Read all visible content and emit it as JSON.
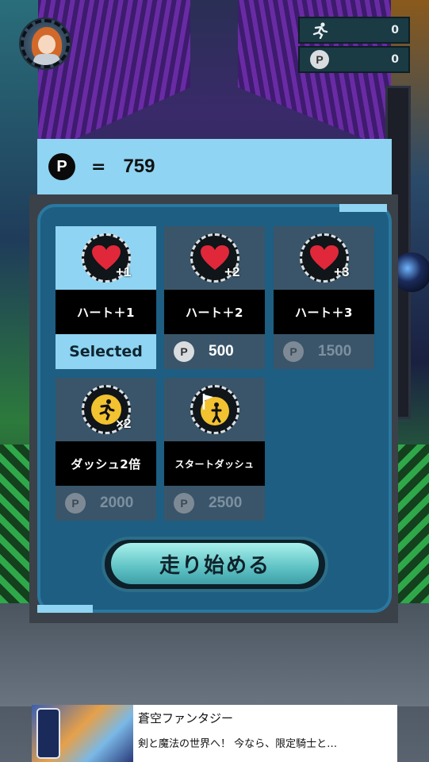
{
  "hud": {
    "run_icon": "running-man-icon",
    "distance": "0",
    "coin_symbol": "P",
    "points": "0"
  },
  "balance": {
    "coin_symbol": "P",
    "equals": "=",
    "value": "759"
  },
  "shop": {
    "items": [
      {
        "name": "ハート＋1",
        "icon": "heart-icon",
        "plus": "+1",
        "status": "Selected"
      },
      {
        "name": "ハート＋2",
        "icon": "heart-icon",
        "plus": "+2",
        "price": "500"
      },
      {
        "name": "ハート＋3",
        "icon": "heart-icon",
        "plus": "+3",
        "price": "1500"
      },
      {
        "name": "ダッシュ2倍",
        "icon": "dash-icon",
        "plus": "×2",
        "price": "2000"
      },
      {
        "name": "スタートダッシュ",
        "icon": "start-dash-flag-icon",
        "price": "2500"
      }
    ],
    "start_label": "走り始める"
  },
  "ad": {
    "title": "蒼空ファンタジー",
    "description": "剣と魔法の世界へ！ 今なら、限定騎士と…"
  },
  "colors": {
    "panel": "#1d5e82",
    "accent": "#8fd4f2",
    "heart": "#e0283a",
    "dash_badge": "#f2c230"
  }
}
